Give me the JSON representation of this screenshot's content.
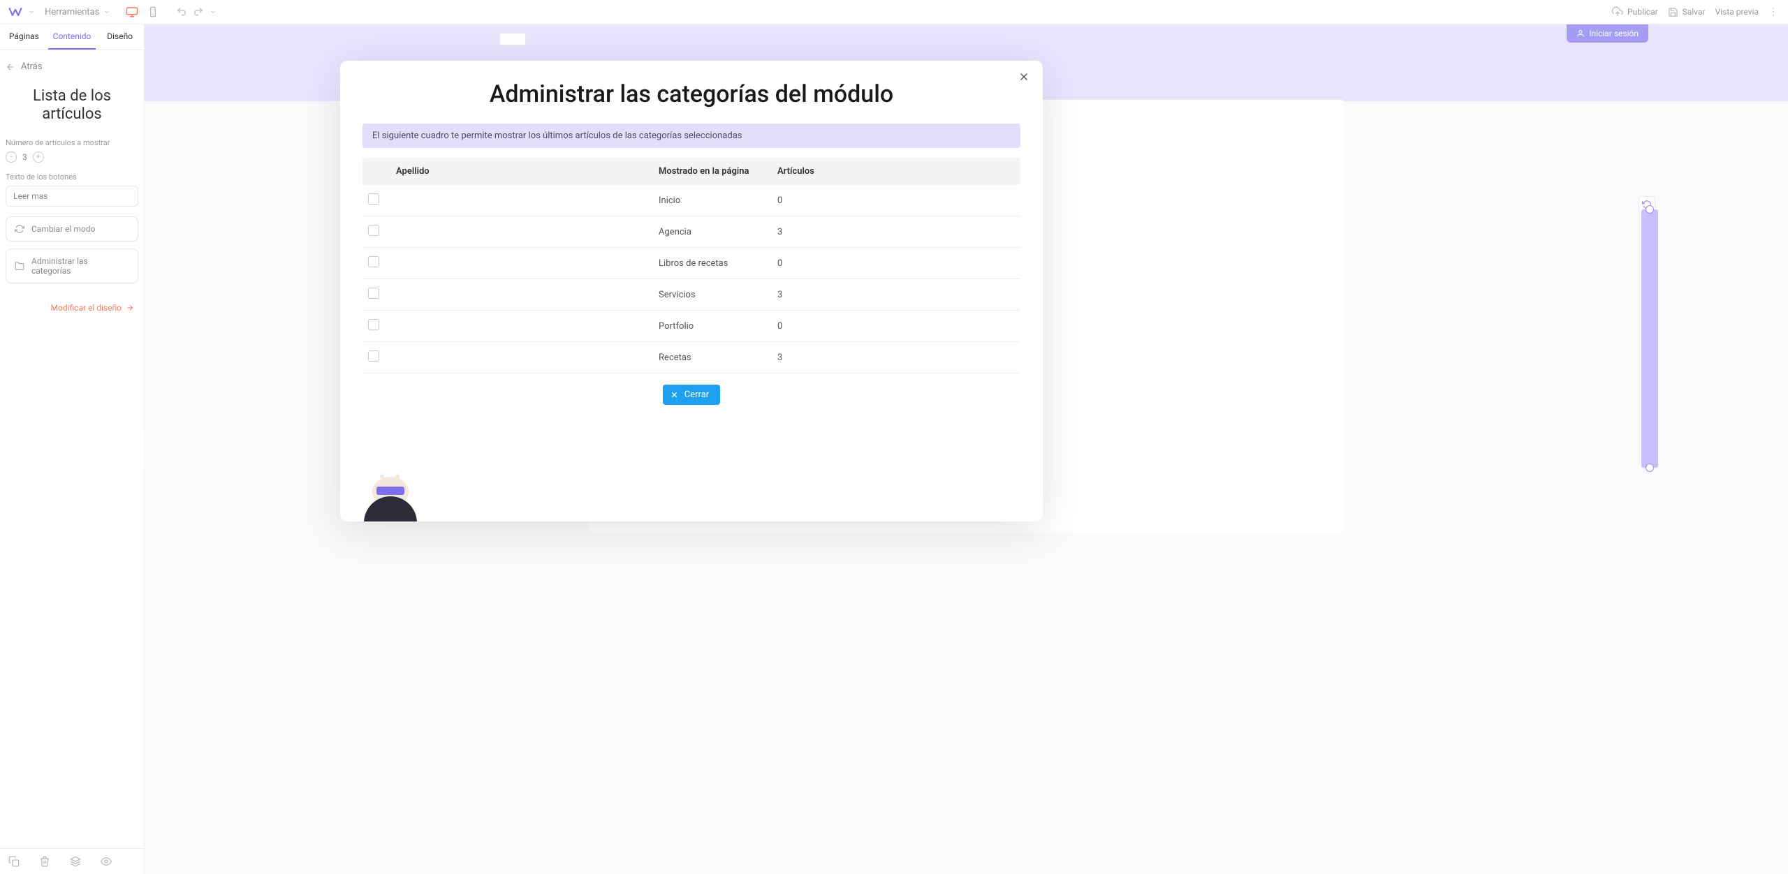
{
  "topbar": {
    "tools_label": "Herramientas",
    "publish": "Publicar",
    "save": "Salvar",
    "preview": "Vista previa"
  },
  "sidebar": {
    "tabs": [
      "Páginas",
      "Contenido",
      "Diseño"
    ],
    "back": "Atrás",
    "title": "Lista de los artículos",
    "field_count_label": "Número de artículos a mostrar",
    "count_value": "3",
    "field_button_text_label": "Texto de los botones",
    "button_text_value": "Leer mas",
    "change_mode": "Cambiar el modo",
    "manage_categories": "Administrar las categorías",
    "modify_design": "Modificar el diseño"
  },
  "canvas": {
    "login": "Iniciar sesión"
  },
  "modal": {
    "title": "Administrar las categorías del módulo",
    "info": "El siguiente cuadro te permite mostrar los últimos artículos de las categorías seleccionadas",
    "columns": {
      "name": "Apellido",
      "page": "Mostrado en la página",
      "articles": "Artículos"
    },
    "rows": [
      {
        "name": "",
        "page": "Inicio",
        "articles": "0"
      },
      {
        "name": "",
        "page": "Agencia",
        "articles": "3"
      },
      {
        "name": "",
        "page": "Libros de recetas",
        "articles": "0"
      },
      {
        "name": "",
        "page": "Servicios",
        "articles": "3"
      },
      {
        "name": "",
        "page": "Portfolio",
        "articles": "0"
      },
      {
        "name": "",
        "page": "Recetas",
        "articles": "3"
      }
    ],
    "close": "Cerrar"
  }
}
